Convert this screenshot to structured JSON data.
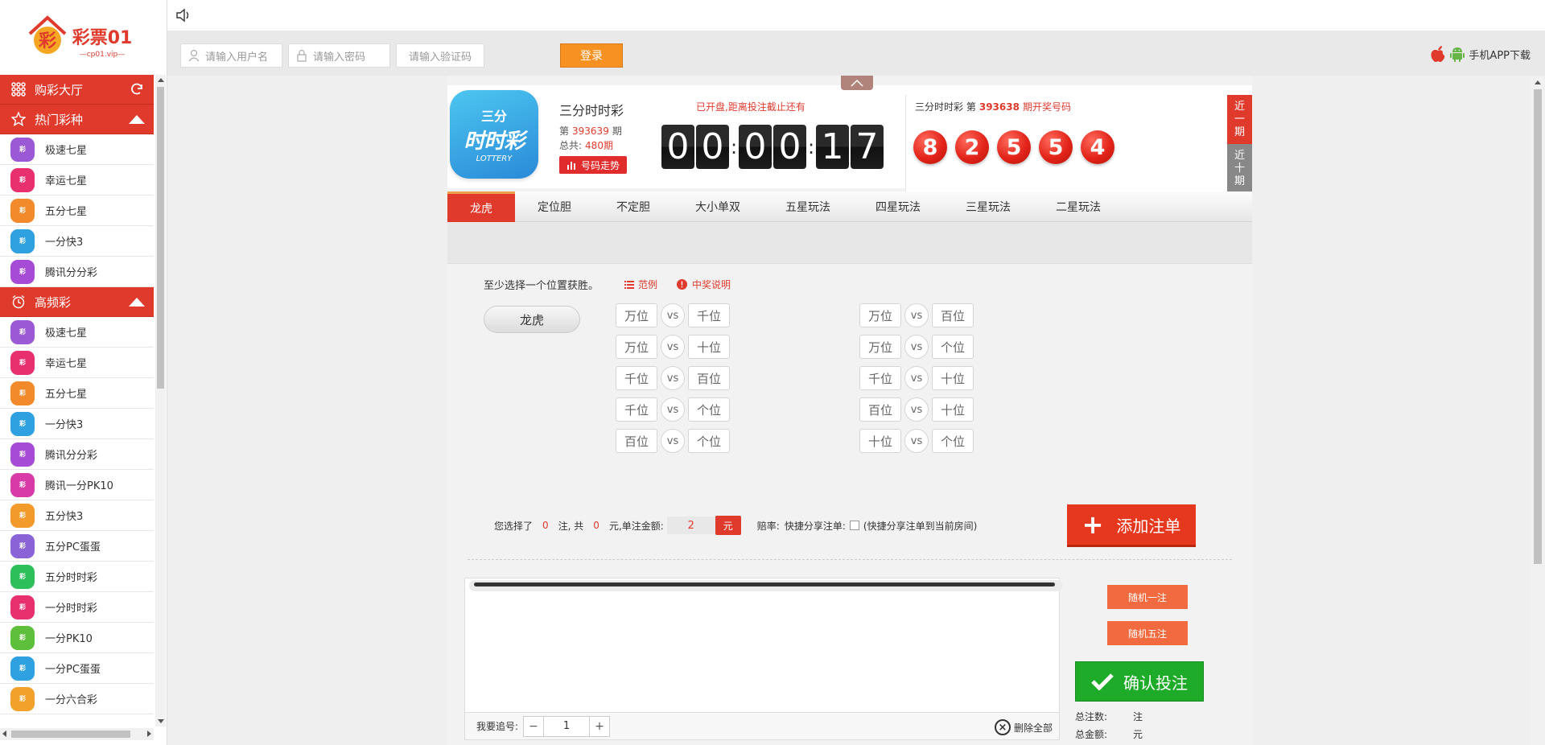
{
  "brand": {
    "logo_main": "彩票01",
    "logo_sub": "cp01.vip"
  },
  "login": {
    "username_placeholder": "请输入用户名",
    "password_placeholder": "请输入密码",
    "captcha_placeholder": "请输入验证码",
    "login_label": "登录",
    "app_download": "手机APP下载"
  },
  "sidebar": {
    "hall_label": "购彩大厅",
    "hot_label": "热门彩种",
    "hot_games": [
      {
        "name": "极速七星",
        "icon": "极速七星-icon",
        "color": "#9b59d6"
      },
      {
        "name": "幸运七星",
        "icon": "幸运七星-icon",
        "color": "#e8306e"
      },
      {
        "name": "五分七星",
        "icon": "五分七星-icon",
        "color": "#f28a2b"
      },
      {
        "name": "一分快3",
        "icon": "一分快3-icon",
        "color": "#2fa0e0"
      },
      {
        "name": "腾讯分分彩",
        "icon": "腾讯分分彩-icon",
        "color": "#a54bd6"
      }
    ],
    "high_label": "高频彩",
    "high_games": [
      {
        "name": "极速七星",
        "icon": "极速七星-icon",
        "color": "#9b59d6"
      },
      {
        "name": "幸运七星",
        "icon": "幸运七星-icon",
        "color": "#e8306e"
      },
      {
        "name": "五分七星",
        "icon": "五分七星-icon",
        "color": "#f28a2b"
      },
      {
        "name": "一分快3",
        "icon": "一分快3-icon",
        "color": "#2fa0e0"
      },
      {
        "name": "腾讯分分彩",
        "icon": "腾讯分分彩-icon",
        "color": "#a54bd6"
      },
      {
        "name": "腾讯一分PK10",
        "icon": "腾讯一分PK10-icon",
        "color": "#d83aa8"
      },
      {
        "name": "五分快3",
        "icon": "五分快3-icon",
        "color": "#f29a2b"
      },
      {
        "name": "五分PC蛋蛋",
        "icon": "五分PC蛋蛋-icon",
        "color": "#8a63d6"
      },
      {
        "name": "五分时时彩",
        "icon": "五分时时彩-icon",
        "color": "#2cbf5a"
      },
      {
        "name": "一分时时彩",
        "icon": "一分时时彩-icon",
        "color": "#e8306e"
      },
      {
        "name": "一分PK10",
        "icon": "一分PK10-icon",
        "color": "#5dbf3a"
      },
      {
        "name": "一分PC蛋蛋",
        "icon": "一分PC蛋蛋-icon",
        "color": "#2fa0e0"
      },
      {
        "name": "一分六合彩",
        "icon": "一分六合彩-icon",
        "color": "#f2a22b"
      }
    ]
  },
  "game": {
    "logo_l1": "三分",
    "logo_l2": "时时彩",
    "logo_l3": "LOTTERY",
    "name": "三分时时彩",
    "issue_prefix": "第",
    "issue": "393639",
    "issue_suffix": "期",
    "total_prefix": "总共:",
    "total": "480期",
    "trend_label": "号码走势",
    "open_msg": "已开盘,距离投注截止还有",
    "countdown": [
      "0",
      "0",
      "0",
      "0",
      "1",
      "7"
    ],
    "draw_game": "三分时时彩",
    "draw_prefix": "第",
    "draw_issue": "393638",
    "draw_suffix": "期开奖号码",
    "draw_numbers": [
      "8",
      "2",
      "5",
      "5",
      "4"
    ],
    "recent1": "近一期",
    "recent10": "近十期",
    "ball_color": "#e3241a"
  },
  "play_tabs": [
    "龙虎",
    "定位胆",
    "不定胆",
    "大小单双",
    "五星玩法",
    "四星玩法",
    "三星玩法",
    "二星玩法"
  ],
  "pick": {
    "hint": "至少选择一个位置获胜。",
    "example": "范例",
    "prize_info": "中奖说明",
    "mode": "龙虎",
    "vs": "vs",
    "pairs_left": [
      [
        "万位",
        "千位"
      ],
      [
        "万位",
        "十位"
      ],
      [
        "千位",
        "百位"
      ],
      [
        "千位",
        "个位"
      ],
      [
        "百位",
        "个位"
      ]
    ],
    "pairs_right": [
      [
        "万位",
        "百位"
      ],
      [
        "万位",
        "个位"
      ],
      [
        "千位",
        "十位"
      ],
      [
        "百位",
        "十位"
      ],
      [
        "十位",
        "个位"
      ]
    ]
  },
  "bet": {
    "selected_prefix": "您选择了",
    "count": "0",
    "count_suffix": "注, 共",
    "amount": "0",
    "amount_suffix": "元,单注金额:",
    "unit_amount": "2",
    "unit": "元",
    "odds_label": "赔率:",
    "share_label": "快捷分享注单:",
    "share_desc": "(快捷分享注单到当前房间)",
    "add_order": "添加注单"
  },
  "order": {
    "chase_label": "我要追号:",
    "chase_value": "1",
    "clear_all": "删除全部",
    "random1": "随机一注",
    "random5": "随机五注",
    "confirm": "确认投注",
    "total_count_label": "总注数:",
    "total_count_unit": "注",
    "total_amount_label": "总金额:",
    "total_amount_unit": "元"
  }
}
